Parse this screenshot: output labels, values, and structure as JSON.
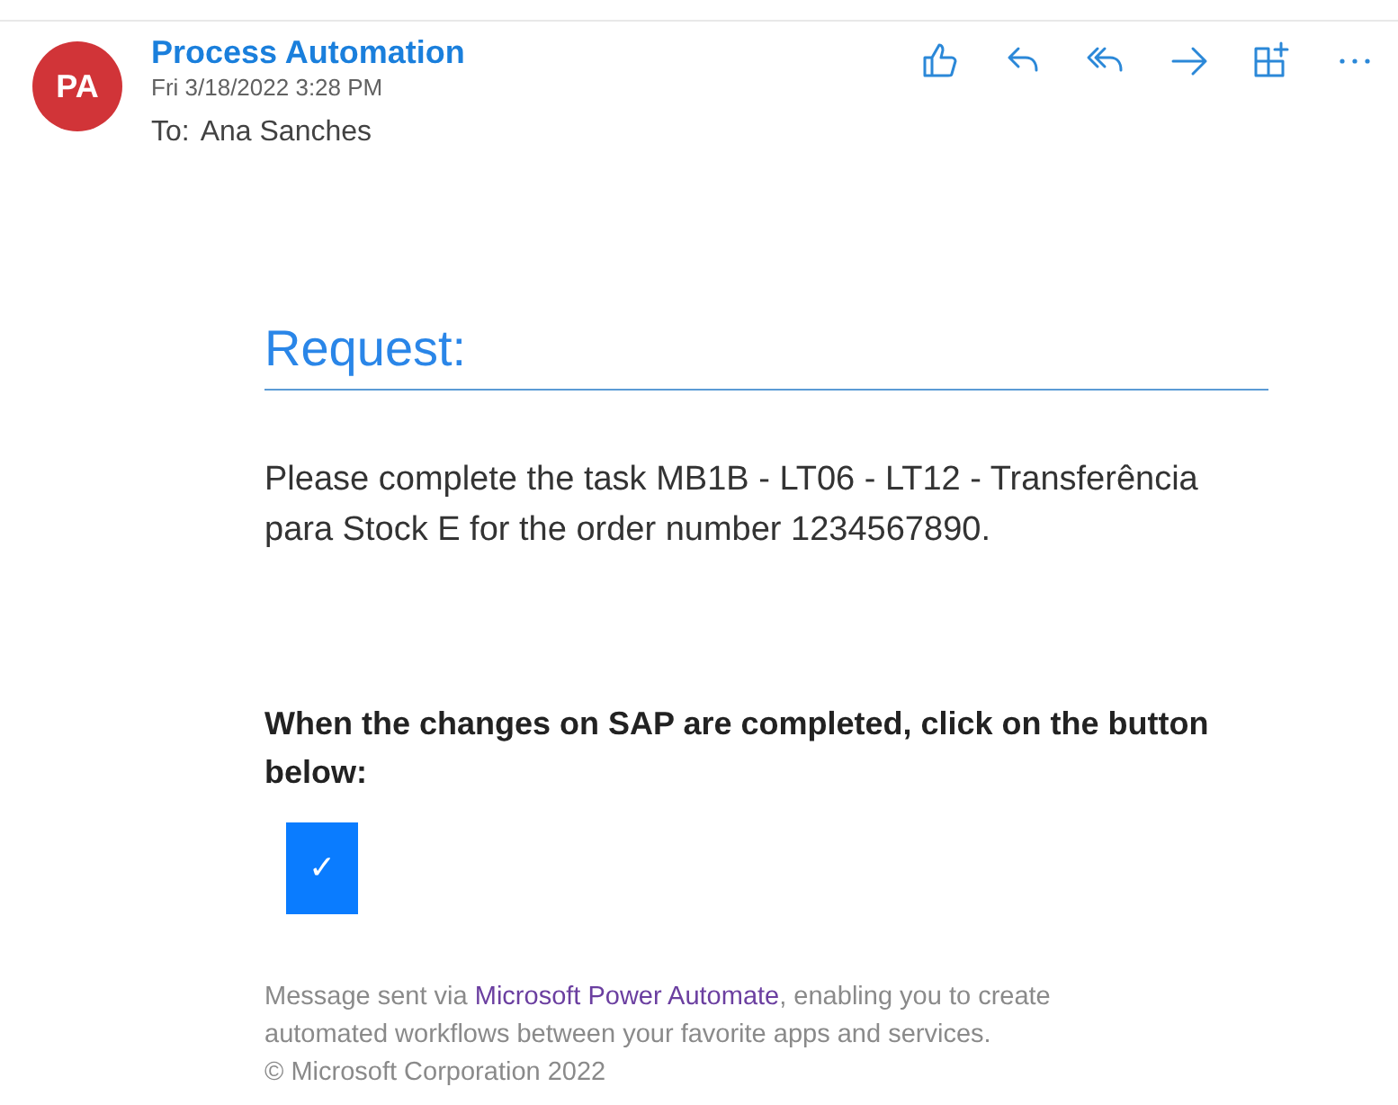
{
  "header": {
    "initials": "PA",
    "sender": "Process Automation",
    "date": "Fri 3/18/2022 3:28 PM",
    "to_label": "To:",
    "recipient": "Ana Sanches"
  },
  "toolbar": [
    {
      "kind": "like"
    },
    {
      "kind": "reply"
    },
    {
      "kind": "reply_all"
    },
    {
      "kind": "forward"
    },
    {
      "kind": "apps"
    },
    {
      "kind": "more"
    }
  ],
  "body": {
    "heading": "Request:",
    "message": "Please complete the task MB1B - LT06 - LT12 - Transferência para Stock E for the order number 1234567890.",
    "instruction": "When the changes on SAP are completed, click on the button below:",
    "button": "✓"
  },
  "footer": {
    "before": "Message sent via ",
    "link": "Microsoft Power Automate",
    "after": ", enabling you to create automated workflows between your favorite apps and services.",
    "copyright": "© Microsoft Corporation 2022"
  }
}
